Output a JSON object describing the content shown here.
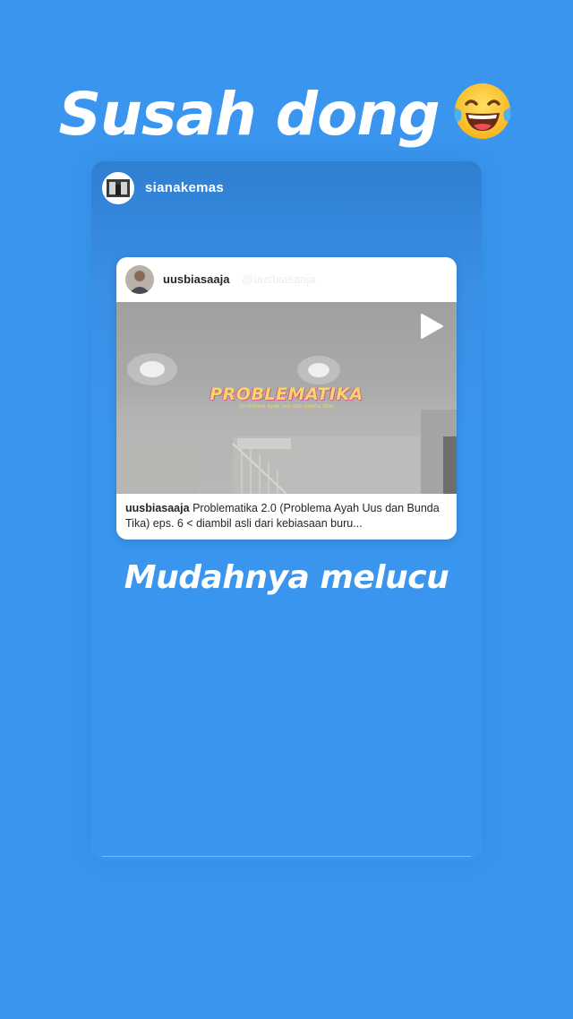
{
  "story": {
    "headline": "Susah dong",
    "headline_emoji": "tears-of-joy-emoji",
    "subheadline": "Mudahnya melucu",
    "background_color": "#3a95ee"
  },
  "shared_by": {
    "username": "sianakemas"
  },
  "post": {
    "username": "uusbiasaaja",
    "username_ghost": "@uusbiasaaja",
    "media_title": "PROBLEMATIKA",
    "media_subtitle": "(problema ayah uus dan bunda tika)",
    "media_type_icon": "play-icon",
    "caption_username": "uusbiasaaja",
    "caption_text": "Problematika 2.0 (Problema Ayah Uus dan Bunda Tika) eps. 6 < diambil asli dari kebiasaan buru..."
  }
}
